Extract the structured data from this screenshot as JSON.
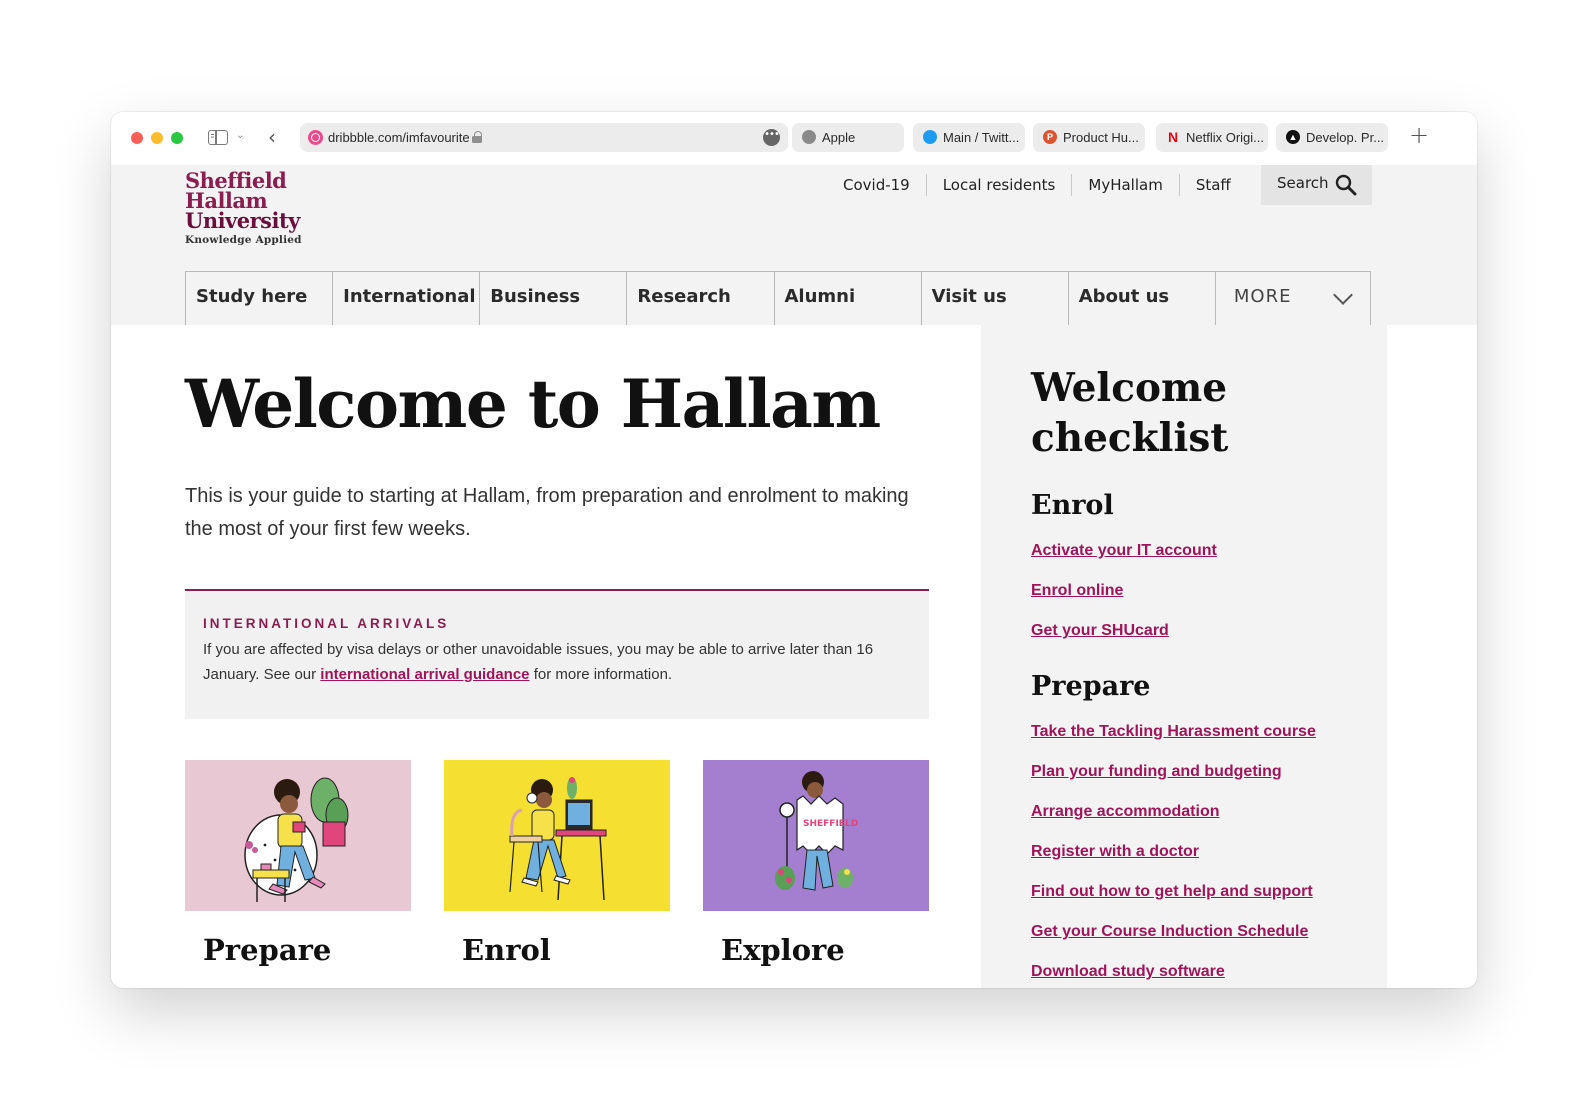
{
  "browser": {
    "url": "dribbble.com/imfavourite",
    "tabs": [
      {
        "label": "Apple",
        "icon": "apple-icon",
        "color": "#8a8a8a"
      },
      {
        "label": "Main / Twitt...",
        "icon": "twitter-icon",
        "color": "#1d9bf0"
      },
      {
        "label": "Product Hu...",
        "icon": "product-hunt-icon",
        "color": "#da552f"
      },
      {
        "label": "Netflix Origi...",
        "icon": "netflix-icon",
        "color": "#e50914"
      },
      {
        "label": "Develop. Pr...",
        "icon": "develop-icon",
        "color": "#111111"
      }
    ]
  },
  "logo": {
    "line1": "Sheffield",
    "line2": "Hallam",
    "line3": "University",
    "tagline": "Knowledge Applied"
  },
  "util_nav": [
    "Covid-19",
    "Local residents",
    "MyHallam",
    "Staff"
  ],
  "search": {
    "label": "Search"
  },
  "main_nav": [
    "Study here",
    "International",
    "Business",
    "Research",
    "Alumni",
    "Visit us",
    "About us"
  ],
  "main_nav_more": "MORE",
  "page": {
    "title": "Welcome to Hallam",
    "intro": "This is your guide to starting at Hallam, from preparation and enrolment to making the most of your first few weeks."
  },
  "notice": {
    "title": "INTERNATIONAL ARRIVALS",
    "body_before": "If you are affected by visa delays or other unavoidable issues, you may be able to arrive later than 16 January. See our ",
    "link": "international arrival guidance",
    "body_after": " for more information."
  },
  "cards": [
    {
      "title": "Prepare",
      "color": "#e8c8d3"
    },
    {
      "title": "Enrol",
      "color": "#f5e031"
    },
    {
      "title": "Explore",
      "color": "#a47fcf"
    }
  ],
  "checklist": {
    "title_line1": "Welcome",
    "title_line2": "checklist",
    "enrol_heading": "Enrol",
    "enrol_links": [
      "Activate your IT account",
      "Enrol online",
      "Get your SHUcard"
    ],
    "prepare_heading": "Prepare",
    "prepare_links": [
      "Take the Tackling Harassment course",
      "Plan your funding and budgeting",
      "Arrange accommodation",
      "Register with a doctor",
      "Find out how to get help and support",
      "Get your Course Induction Schedule",
      "Download study software"
    ]
  },
  "colors": {
    "brand": "#8c1d4f",
    "link": "#a0155a"
  }
}
